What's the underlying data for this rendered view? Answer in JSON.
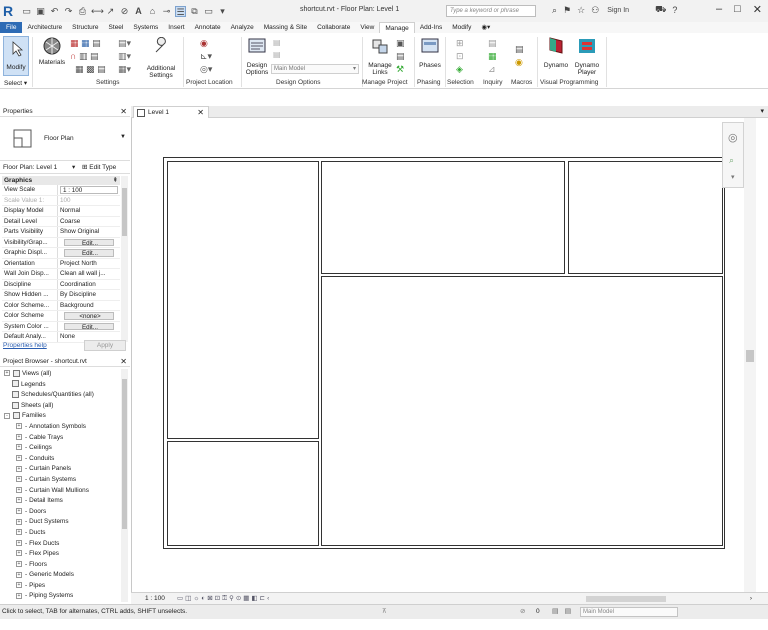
{
  "app": {
    "logo": "R",
    "title": "shortcut.rvt - Floor Plan: Level 1",
    "search_placeholder": "Type a keyword or phrase",
    "sign_in": "Sign In"
  },
  "ribbon_tabs": [
    "File",
    "Architecture",
    "Structure",
    "Steel",
    "Systems",
    "Insert",
    "Annotate",
    "Analyze",
    "Massing & Site",
    "Collaborate",
    "View",
    "Manage",
    "Add-Ins",
    "Modify"
  ],
  "active_tab": "Manage",
  "ribbon": {
    "modify": "Modify",
    "materials": "Materials",
    "additional_settings_1": "Additional",
    "additional_settings_2": "Settings",
    "design_options_1": "Design",
    "design_options_2": "Options",
    "main_model": "Main Model",
    "manage_links_1": "Manage",
    "manage_links_2": "Links",
    "phases": "Phases",
    "dynamo": "Dynamo",
    "dynamo_player_1": "Dynamo",
    "dynamo_player_2": "Player",
    "panels": {
      "select": "Select ▾",
      "settings": "Settings",
      "project_location": "Project Location",
      "design_options": "Design Options",
      "manage_project": "Manage Project",
      "phasing": "Phasing",
      "selection": "Selection",
      "inquiry": "Inquiry",
      "macros": "Macros",
      "visual_programming": "Visual Programming"
    }
  },
  "properties": {
    "header": "Properties",
    "type_name": "Floor Plan",
    "instance": "Floor Plan: Level 1",
    "edit_type": "Edit Type",
    "group": "Graphics",
    "rows": [
      {
        "k": "View Scale",
        "v": "1 : 100"
      },
      {
        "k": "Scale Value    1:",
        "v": "100"
      },
      {
        "k": "Display Model",
        "v": "Normal"
      },
      {
        "k": "Detail Level",
        "v": "Coarse"
      },
      {
        "k": "Parts Visibility",
        "v": "Show Original"
      },
      {
        "k": "Visibility/Grap...",
        "v": "Edit..."
      },
      {
        "k": "Graphic Displ...",
        "v": "Edit..."
      },
      {
        "k": "Orientation",
        "v": "Project North"
      },
      {
        "k": "Wall Join Disp...",
        "v": "Clean all wall j..."
      },
      {
        "k": "Discipline",
        "v": "Coordination"
      },
      {
        "k": "Show Hidden ...",
        "v": "By Discipline"
      },
      {
        "k": "Color Scheme...",
        "v": "Background"
      },
      {
        "k": "Color Scheme",
        "v": "<none>"
      },
      {
        "k": "System Color ...",
        "v": "Edit..."
      },
      {
        "k": "Default Analy...",
        "v": "None"
      }
    ],
    "help": "Properties help",
    "apply": "Apply"
  },
  "browser": {
    "header": "Project Browser - shortcut.rvt",
    "items": [
      {
        "label": "Views (all)",
        "level": 0,
        "toggle": "+"
      },
      {
        "label": "Legends",
        "level": 1,
        "toggle": ""
      },
      {
        "label": "Schedules/Quantities (all)",
        "level": 1,
        "toggle": ""
      },
      {
        "label": "Sheets (all)",
        "level": 1,
        "toggle": ""
      },
      {
        "label": "Families",
        "level": 0,
        "toggle": "-"
      },
      {
        "label": "Annotation Symbols",
        "level": 2,
        "toggle": "+"
      },
      {
        "label": "Cable Trays",
        "level": 2,
        "toggle": "+"
      },
      {
        "label": "Ceilings",
        "level": 2,
        "toggle": "+"
      },
      {
        "label": "Conduits",
        "level": 2,
        "toggle": "+"
      },
      {
        "label": "Curtain Panels",
        "level": 2,
        "toggle": "+"
      },
      {
        "label": "Curtain Systems",
        "level": 2,
        "toggle": "+"
      },
      {
        "label": "Curtain Wall Mullions",
        "level": 2,
        "toggle": "+"
      },
      {
        "label": "Detail Items",
        "level": 2,
        "toggle": "+"
      },
      {
        "label": "Doors",
        "level": 2,
        "toggle": "+"
      },
      {
        "label": "Duct Systems",
        "level": 2,
        "toggle": "+"
      },
      {
        "label": "Ducts",
        "level": 2,
        "toggle": "+"
      },
      {
        "label": "Flex Ducts",
        "level": 2,
        "toggle": "+"
      },
      {
        "label": "Flex Pipes",
        "level": 2,
        "toggle": "+"
      },
      {
        "label": "Floors",
        "level": 2,
        "toggle": "+"
      },
      {
        "label": "Generic Models",
        "level": 2,
        "toggle": "+"
      },
      {
        "label": "Pipes",
        "level": 2,
        "toggle": "+"
      },
      {
        "label": "Piping Systems",
        "level": 2,
        "toggle": "+"
      }
    ]
  },
  "view": {
    "tab": "Level 1",
    "scale": "1 : 100"
  },
  "status": {
    "message": "Click to select, TAB for alternates, CTRL adds, SHIFT unselects.",
    "zero": "0",
    "model": "Main Model"
  },
  "colors": {
    "file_tab": "#2d6bb5",
    "logo": "#1f5fa8"
  }
}
